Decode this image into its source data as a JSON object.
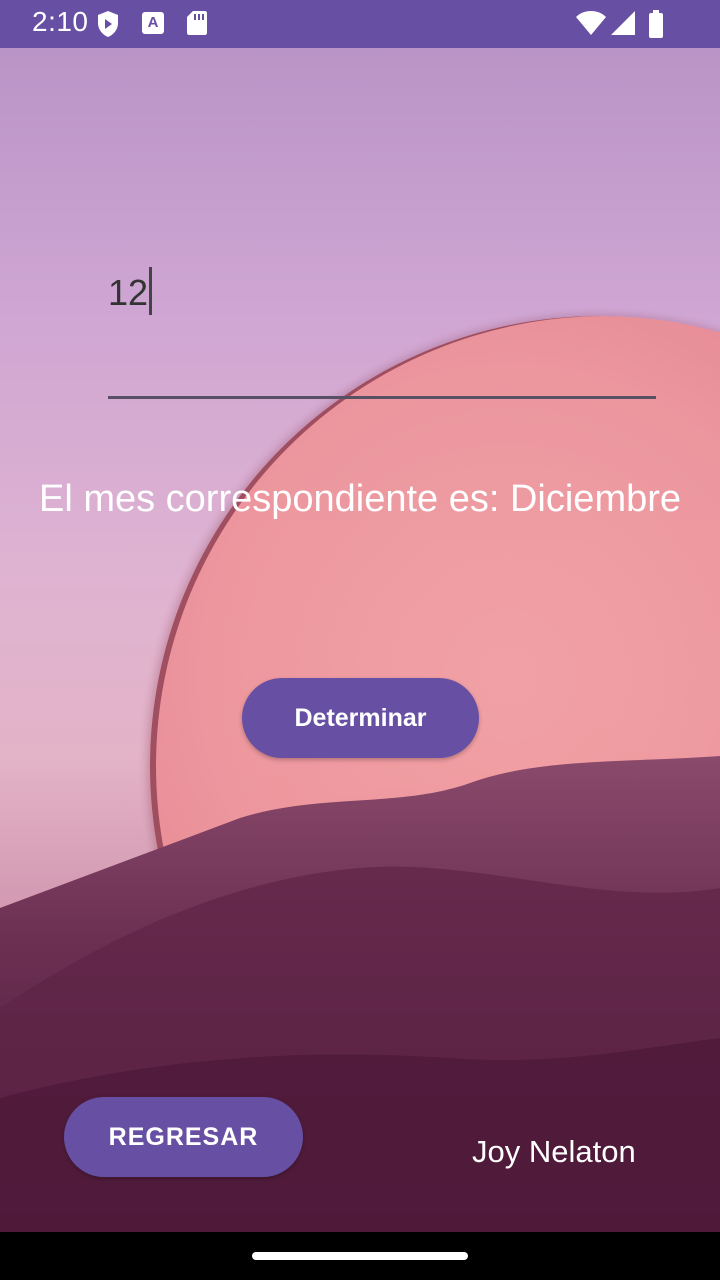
{
  "status_bar": {
    "time": "2:10",
    "icons": [
      "shield-icon",
      "a-icon",
      "sdcard-icon",
      "wifi-icon",
      "signal-icon",
      "battery-icon"
    ],
    "a_glyph": "A"
  },
  "input": {
    "value": "12"
  },
  "result_text": "El mes correspondiente es: Diciembre",
  "buttons": {
    "determinar": "Determinar",
    "regresar": "REGRESAR"
  },
  "author": "Joy Nelaton",
  "colors": {
    "primary": "#6750a4",
    "text_on_primary": "#ffffff"
  }
}
